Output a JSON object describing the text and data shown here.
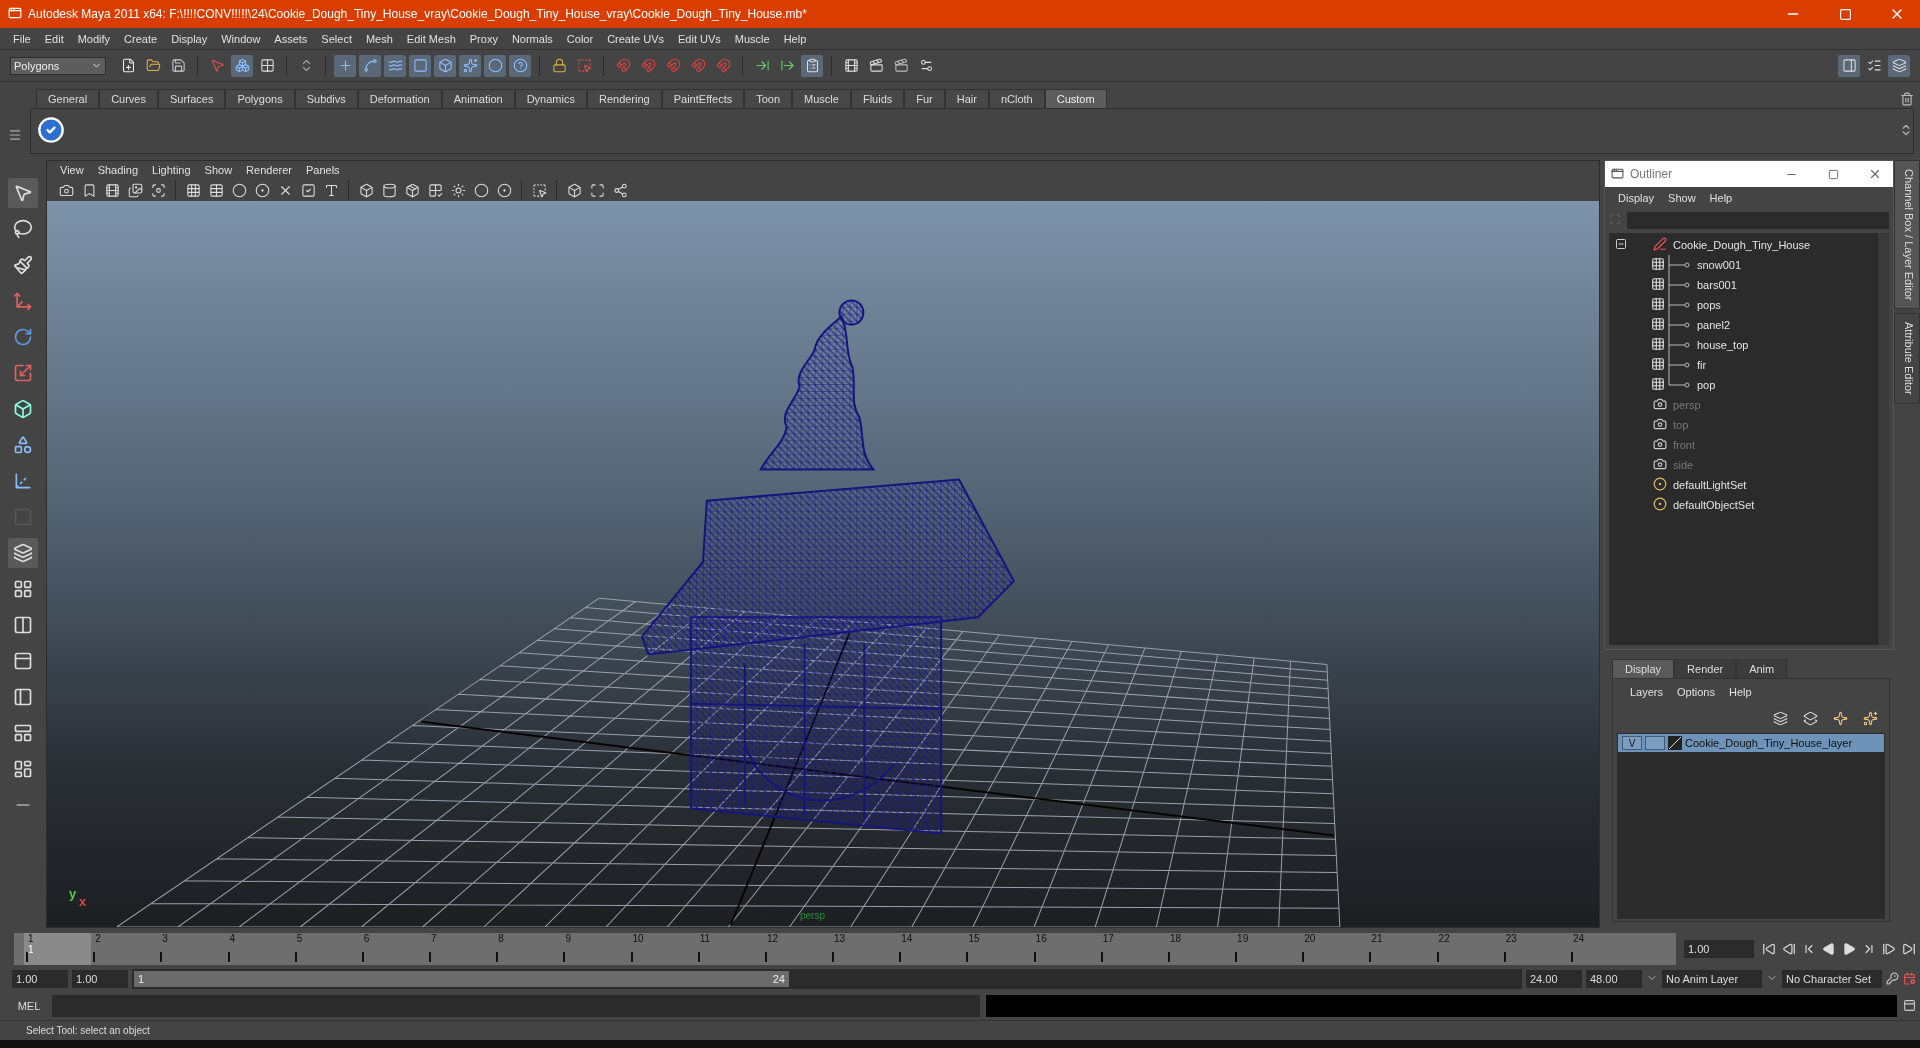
{
  "window": {
    "title": "Autodesk Maya 2011 x64: F:\\!!!!CONV!!!!!\\24\\Cookie_Dough_Tiny_House_vray\\Cookie_Dough_Tiny_House_vray\\Cookie_Dough_Tiny_House.mb*"
  },
  "menu": [
    "File",
    "Edit",
    "Modify",
    "Create",
    "Display",
    "Window",
    "Assets",
    "Select",
    "Mesh",
    "Edit Mesh",
    "Proxy",
    "Normals",
    "Color",
    "Create UVs",
    "Edit UVs",
    "Muscle",
    "Help"
  ],
  "status_line": {
    "mode": "Polygons"
  },
  "shelf": {
    "tabs": [
      {
        "label": "General",
        "selected": false
      },
      {
        "label": "Curves",
        "selected": false
      },
      {
        "label": "Surfaces",
        "selected": false
      },
      {
        "label": "Polygons",
        "selected": false
      },
      {
        "label": "Subdivs",
        "selected": false
      },
      {
        "label": "Deformation",
        "selected": false
      },
      {
        "label": "Animation",
        "selected": false
      },
      {
        "label": "Dynamics",
        "selected": false
      },
      {
        "label": "Rendering",
        "selected": false
      },
      {
        "label": "PaintEffects",
        "selected": false
      },
      {
        "label": "Toon",
        "selected": false
      },
      {
        "label": "Muscle",
        "selected": false
      },
      {
        "label": "Fluids",
        "selected": false
      },
      {
        "label": "Fur",
        "selected": false
      },
      {
        "label": "Hair",
        "selected": false
      },
      {
        "label": "nCloth",
        "selected": false
      },
      {
        "label": "Custom",
        "selected": true
      }
    ]
  },
  "viewport": {
    "menu": [
      "View",
      "Shading",
      "Lighting",
      "Show",
      "Renderer",
      "Panels"
    ],
    "camera": "persp",
    "axis_y": "y",
    "axis_x": "x"
  },
  "outliner": {
    "title": "Outliner",
    "menu": [
      "Display",
      "Show",
      "Help"
    ],
    "items": [
      {
        "label": "Cookie_Dough_Tiny_House",
        "kind": "group",
        "expanded": true,
        "dimmed": false,
        "children": [
          {
            "label": "snow001",
            "kind": "mesh",
            "dimmed": false
          },
          {
            "label": "bars001",
            "kind": "mesh",
            "dimmed": false
          },
          {
            "label": "pops",
            "kind": "mesh",
            "dimmed": false
          },
          {
            "label": "panel2",
            "kind": "mesh",
            "dimmed": false
          },
          {
            "label": "house_top",
            "kind": "mesh",
            "dimmed": false
          },
          {
            "label": "fir",
            "kind": "mesh",
            "dimmed": false
          },
          {
            "label": "pop",
            "kind": "mesh",
            "dimmed": false
          }
        ]
      },
      {
        "label": "persp",
        "kind": "camera",
        "dimmed": true
      },
      {
        "label": "top",
        "kind": "camera",
        "dimmed": true
      },
      {
        "label": "front",
        "kind": "camera",
        "dimmed": true
      },
      {
        "label": "side",
        "kind": "camera",
        "dimmed": true
      },
      {
        "label": "defaultLightSet",
        "kind": "set",
        "dimmed": false
      },
      {
        "label": "defaultObjectSet",
        "kind": "set",
        "dimmed": false
      }
    ]
  },
  "layer_editor": {
    "tabs": [
      {
        "label": "Display",
        "selected": true
      },
      {
        "label": "Render",
        "selected": false
      },
      {
        "label": "Anim",
        "selected": false
      }
    ],
    "menu": [
      "Layers",
      "Options",
      "Help"
    ],
    "layers": [
      {
        "name": "Cookie_Dough_Tiny_House_layer",
        "visibility": "V",
        "selected": true
      }
    ]
  },
  "side_tabs": [
    {
      "label": "Channel Box / Layer Editor",
      "selected": true
    },
    {
      "label": "Attribute Editor",
      "selected": false
    }
  ],
  "timeline": {
    "current": "1",
    "ticks": [
      {
        "label": "1",
        "selected": true
      },
      {
        "label": "2",
        "selected": false
      },
      {
        "label": "3",
        "selected": false
      },
      {
        "label": "4",
        "selected": false
      },
      {
        "label": "5",
        "selected": false
      },
      {
        "label": "6",
        "selected": false
      },
      {
        "label": "7",
        "selected": false
      },
      {
        "label": "8",
        "selected": false
      },
      {
        "label": "9",
        "selected": false
      },
      {
        "label": "10",
        "selected": false
      },
      {
        "label": "11",
        "selected": false
      },
      {
        "label": "12",
        "selected": false
      },
      {
        "label": "13",
        "selected": false
      },
      {
        "label": "14",
        "selected": false
      },
      {
        "label": "15",
        "selected": false
      },
      {
        "label": "16",
        "selected": false
      },
      {
        "label": "17",
        "selected": false
      },
      {
        "label": "18",
        "selected": false
      },
      {
        "label": "19",
        "selected": false
      },
      {
        "label": "20",
        "selected": false
      },
      {
        "label": "21",
        "selected": false
      },
      {
        "label": "22",
        "selected": false
      },
      {
        "label": "23",
        "selected": false
      },
      {
        "label": "24",
        "selected": false
      }
    ],
    "current_time": "1.00"
  },
  "range": {
    "start": "1.00",
    "playback_start": "1.00",
    "slider_start": "1",
    "slider_end": "24",
    "playback_end": "24.00",
    "end": "48.00",
    "anim_layer": "No Anim Layer",
    "character_set": "No Character Set"
  },
  "command_line": {
    "label": "MEL"
  },
  "help_line": "Select Tool: select an object"
}
